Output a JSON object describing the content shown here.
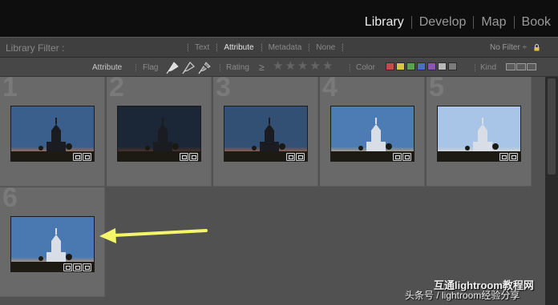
{
  "modules": {
    "items": [
      "Library",
      "Develop",
      "Map",
      "Book"
    ],
    "active": "Library"
  },
  "library_filter": {
    "title": "Library Filter :",
    "tabs": [
      {
        "label": "Text",
        "active": false
      },
      {
        "label": "Attribute",
        "active": true
      },
      {
        "label": "Metadata",
        "active": false
      },
      {
        "label": "None",
        "active": false
      }
    ],
    "preset": "No Filter ÷",
    "lock_icon": "lock-icon"
  },
  "attribute_bar": {
    "title": "Attribute",
    "flag_label": "Flag",
    "flag_icons": [
      "flag-picked-icon",
      "flag-unflagged-icon",
      "flag-rejected-icon"
    ],
    "rating_label": "Rating",
    "rating_operator": "≥",
    "star_count": 5,
    "color_label": "Color",
    "color_labels": [
      "#c44b4b",
      "#d8c63c",
      "#5aa34e",
      "#4a6fc0",
      "#8b55b2",
      "#b8b8b8",
      "#7b7b7b"
    ],
    "kind_label": "Kind",
    "kind_icons": [
      "kind-master-icon",
      "kind-virtual-copy-icon",
      "kind-video-icon"
    ]
  },
  "grid": {
    "cells": [
      {
        "number": "1",
        "sky": "#3a5f8c",
        "sky_bottom": "#e07a3a",
        "brightness": 0.55
      },
      {
        "number": "2",
        "sky": "#1b2736",
        "sky_bottom": "#6b3a22",
        "brightness": 0.25
      },
      {
        "number": "3",
        "sky": "#324f74",
        "sky_bottom": "#d06c34",
        "brightness": 0.45
      },
      {
        "number": "4",
        "sky": "#4c7cb3",
        "sky_bottom": "#e8b06a",
        "brightness": 0.7
      },
      {
        "number": "5",
        "sky": "#a8c4e6",
        "sky_bottom": "#f1e3cf",
        "brightness": 0.95
      },
      {
        "number": "6",
        "sky": "#4a79b2",
        "sky_bottom": "#e8a060",
        "brightness": 0.75
      }
    ]
  },
  "watermark": {
    "line1": "互通lightroom教程网",
    "line2": "头条号 / lightroom经验分享"
  },
  "colors": {
    "arrow": "#f5f56a",
    "topbar": "#0e0e0e",
    "cell": "#696969"
  }
}
